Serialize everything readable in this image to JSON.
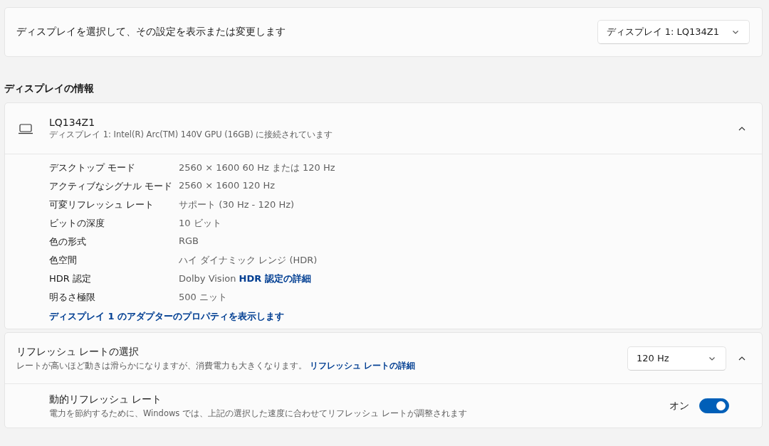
{
  "display_select": {
    "label": "ディスプレイを選択して、その設定を表示または変更します",
    "dropdown": "ディスプレイ 1: LQ134Z1"
  },
  "section_heading": "ディスプレイの情報",
  "display_info": {
    "name": "LQ134Z1",
    "subtitle": "ディスプレイ 1: Intel(R) Arc(TM) 140V GPU (16GB) に接続されています",
    "expanded": true,
    "rows": [
      {
        "label": "デスクトップ モード",
        "value": "2560 × 1600 60 Hz または 120 Hz"
      },
      {
        "label": "アクティブなシグナル モード",
        "value": "2560 × 1600 120 Hz"
      },
      {
        "label": "可変リフレッシュ レート",
        "value": "サポート (30 Hz - 120 Hz)"
      },
      {
        "label": "ビットの深度",
        "value": "10 ビット"
      },
      {
        "label": "色の形式",
        "value": "RGB"
      },
      {
        "label": "色空間",
        "value": "ハイ ダイナミック レンジ (HDR)"
      },
      {
        "label": "HDR 認定",
        "value": "Dolby Vision",
        "link": "HDR 認定の詳細"
      },
      {
        "label": "明るさ極限",
        "value": "500 ニット"
      }
    ],
    "adapter_link": "ディスプレイ 1 のアダプターのプロパティを表示します"
  },
  "refresh_rate": {
    "title": "リフレッシュ レートの選択",
    "description": "レートが高いほど動きは滑らかになりますが、消費電力も大きくなります。",
    "link": "リフレッシュ レートの詳細",
    "dropdown": "120 Hz",
    "expanded": true,
    "dynamic": {
      "title": "動的リフレッシュ レート",
      "description": "電力を節約するために、Windows では、上記の選択した速度に合わせてリフレッシュ レートが調整されます",
      "state_label": "オン",
      "on": true
    }
  }
}
